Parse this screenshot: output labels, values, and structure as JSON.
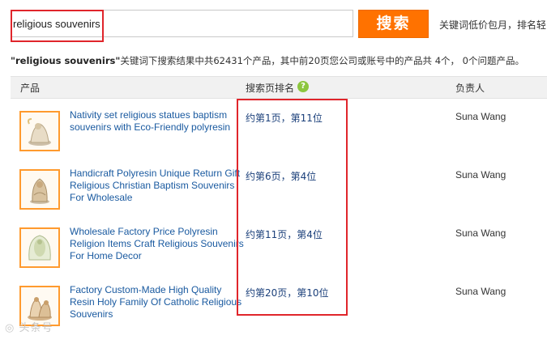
{
  "search": {
    "value": "religious souvenirs",
    "button_label": "搜索",
    "note": "关键词低价包月，排名轻"
  },
  "summary": {
    "keyword": "\"religious souvenirs\"",
    "text": "关键词下搜索结果中共62431个产品，其中前20页您公司或账号中的产品共 4个，  0个问题产品。"
  },
  "table": {
    "headers": {
      "product": "产品",
      "rank": "搜索页排名",
      "owner": "负责人"
    },
    "help_glyph": "?",
    "rows": [
      {
        "title": "Nativity set religious statues baptism souvenirs with Eco-Friendly polyresin",
        "rank": "约第1页，第11位",
        "owner": "Suna Wang"
      },
      {
        "title": "Handicraft Polyresin Unique Return Gift Religious Christian Baptism Souvenirs For Wholesale",
        "rank": "约第6页，第4位",
        "owner": "Suna Wang"
      },
      {
        "title": "Wholesale Factory Price Polyresin Religion Items Craft Religious Souvenirs For Home Decor",
        "rank": "约第11页，第4位",
        "owner": "Suna Wang"
      },
      {
        "title": "Factory Custom-Made High Quality Resin Holy Family Of Catholic Religious Souvenirs",
        "rank": "约第20页，第10位",
        "owner": "Suna Wang"
      }
    ]
  },
  "watermark": "头条号"
}
